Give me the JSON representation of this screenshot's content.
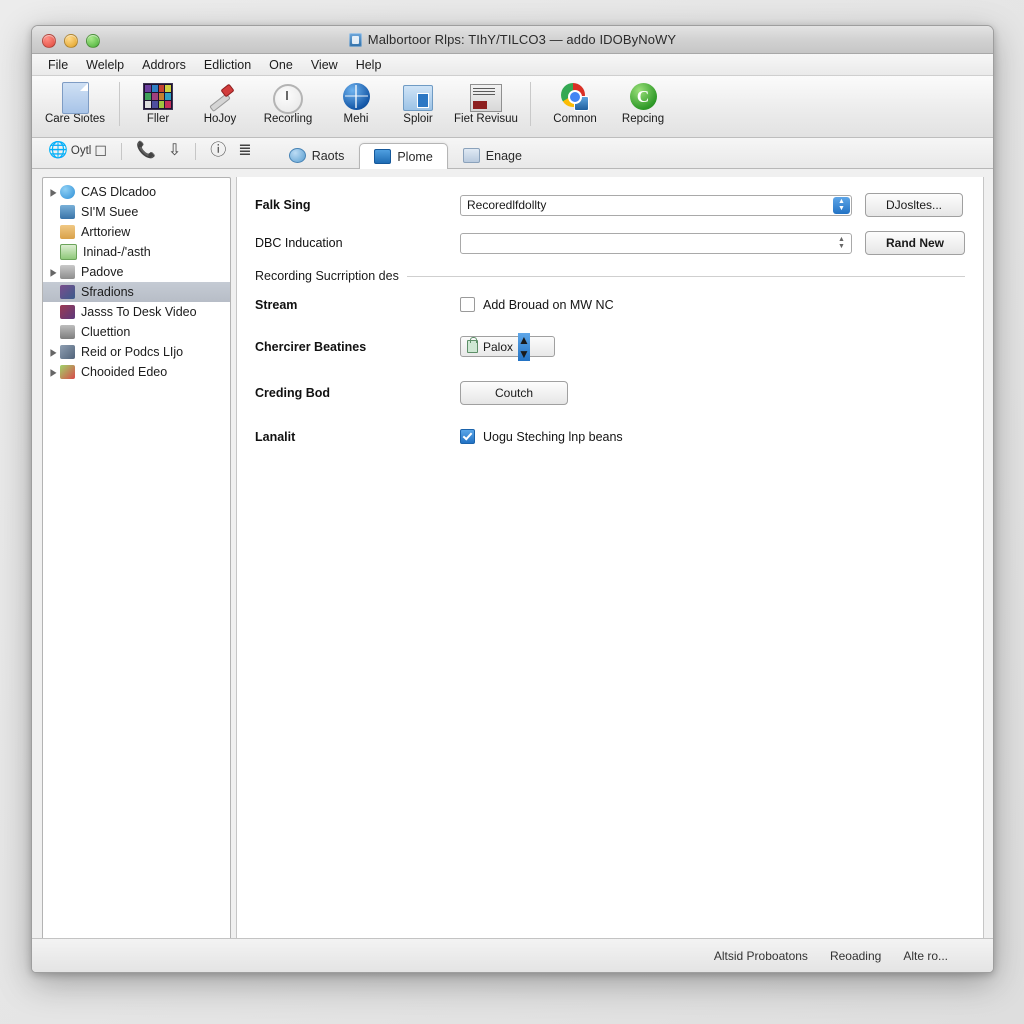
{
  "window": {
    "title": "Malbortoor Rlps: TIhY/TILCO3 — addo IDOByNoWY",
    "title_icon": "app-window-icon",
    "traffic_lights": [
      "close",
      "minimize",
      "maximize"
    ]
  },
  "menubar": {
    "items": [
      {
        "label": "File"
      },
      {
        "label": "Welelp"
      },
      {
        "label": "Addrors"
      },
      {
        "label": "Edliction"
      },
      {
        "label": "One"
      },
      {
        "label": "View"
      },
      {
        "label": "Help"
      }
    ]
  },
  "toolbar": {
    "items": [
      {
        "label": "Care Siotes",
        "icon": "document-icon"
      },
      {
        "label": "Fller",
        "icon": "color-grid-icon"
      },
      {
        "label": "HoJoy",
        "icon": "hammer-icon"
      },
      {
        "label": "Recorling",
        "icon": "clock-icon"
      },
      {
        "label": "Mehi",
        "icon": "globe-icon"
      },
      {
        "label": "Sploir",
        "icon": "blue-folder-icon"
      },
      {
        "label": "Fiet Revisuu",
        "icon": "document-stack-icon"
      },
      {
        "label": "Comnon",
        "icon": "chrome-map-icon"
      },
      {
        "label": "Repcing",
        "icon": "green-circle-icon"
      }
    ]
  },
  "secondbar": {
    "tools": [
      {
        "label": "Oytl",
        "icon": "globe-small-icon"
      },
      {
        "label": "",
        "icon": "window-icon"
      },
      {
        "label": "",
        "icon": "phone-icon"
      },
      {
        "label": "",
        "icon": "download-icon"
      },
      {
        "label": "",
        "icon": "info-icon"
      },
      {
        "label": "",
        "icon": "list-icon"
      }
    ],
    "tabs": [
      {
        "label": "Raots",
        "icon": "blue-ball-icon",
        "active": false
      },
      {
        "label": "Plome",
        "icon": "card-icon",
        "active": true
      },
      {
        "label": "Enage",
        "icon": "book-icon",
        "active": false
      }
    ]
  },
  "sidebar": {
    "items": [
      {
        "label": "CAS Dlcadoo",
        "expandable": true,
        "icon_color": "#2e8fd6",
        "selected": false
      },
      {
        "label": "SI'M Suee",
        "expandable": false,
        "icon_color": "#3a74a8",
        "selected": false
      },
      {
        "label": "Arttoriew",
        "expandable": false,
        "icon_color": "#d9a14a",
        "selected": false
      },
      {
        "label": "Ininad-/'asth",
        "expandable": false,
        "icon_color": "#8fc97a",
        "selected": false
      },
      {
        "label": "Padove",
        "expandable": true,
        "icon_color": "#9a9a9a",
        "selected": false
      },
      {
        "label": "Sfradions",
        "expandable": false,
        "icon_color": "#7a4d8c",
        "selected": true
      },
      {
        "label": "Jasss To Desk Video",
        "expandable": false,
        "icon_color": "#9c3a52",
        "selected": false
      },
      {
        "label": "Cluettion",
        "expandable": false,
        "icon_color": "#8d8d8d",
        "selected": false
      },
      {
        "label": "Reid or Podcs LIjo",
        "expandable": true,
        "icon_color": "#6b7f94",
        "selected": false
      },
      {
        "label": "Chooided Edeo",
        "expandable": true,
        "icon_color": "#6fbf4a",
        "selected": false
      }
    ]
  },
  "form": {
    "fields": [
      {
        "label": "Falk Sing",
        "value": "Recoredlfdollty",
        "stepper": "blue",
        "button": "DJosltes..."
      },
      {
        "label": "DBC Inducation",
        "value": "",
        "stepper": "grey",
        "button": "Rand New"
      }
    ],
    "group_title": "Recording Sucrription des",
    "rows": [
      {
        "label": "Stream",
        "type": "checkbox",
        "checked": false,
        "text": "Add Brouad on MW NC"
      },
      {
        "label": "Chercirer Beatines",
        "type": "combo",
        "value": "Palox",
        "icon": "lock-icon"
      },
      {
        "label": "Creding Bod",
        "type": "button",
        "text": "Coutch"
      },
      {
        "label": "Lanalit",
        "type": "checkbox",
        "checked": true,
        "text": "Uogu Steching lnp beans"
      }
    ]
  },
  "statusbar": {
    "items": [
      {
        "label": "Altsid Proboatons"
      },
      {
        "label": "Reoading"
      },
      {
        "label": "Alte ro..."
      }
    ]
  },
  "colors": {
    "accent": "#2272c4",
    "selection": "#bcc2cb",
    "window_bg": "#efefef"
  }
}
